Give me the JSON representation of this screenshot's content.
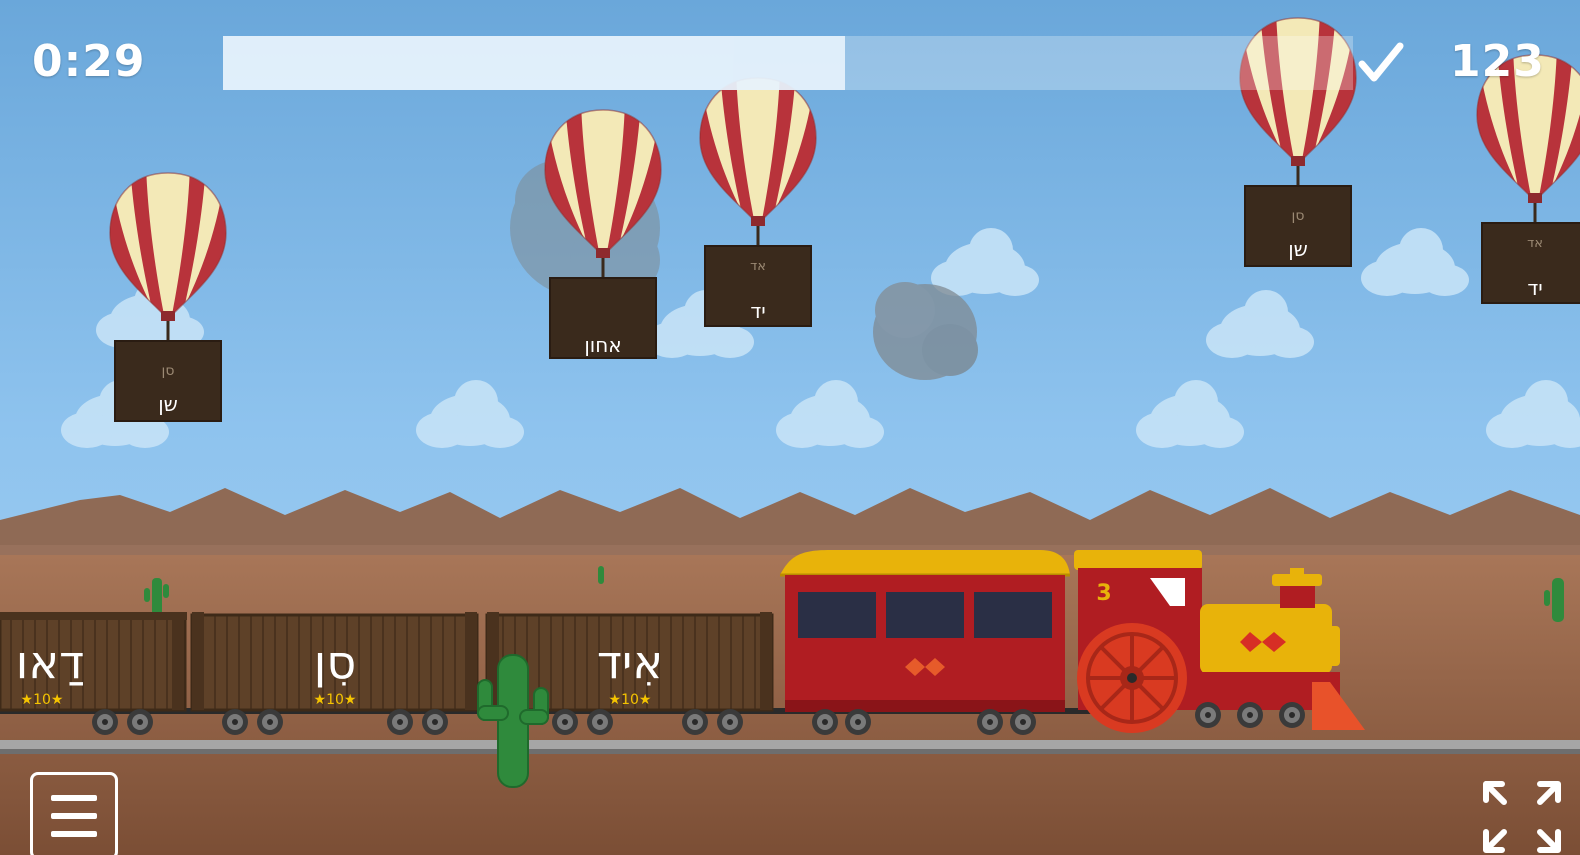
{
  "hud": {
    "timer": "0:29",
    "score": "123",
    "progress_fraction": 0.55
  },
  "balloons": [
    {
      "crate_small": "סן",
      "crate_main": "שן"
    },
    {
      "crate_small": "",
      "crate_main": "אחון"
    },
    {
      "crate_small": "אד",
      "crate_main": "יד"
    },
    {
      "crate_small": "סן",
      "crate_main": "שן"
    },
    {
      "crate_small": "אד",
      "crate_main": "יד"
    }
  ],
  "train": {
    "engine_number": "3",
    "wagons": [
      {
        "word": "דַאו",
        "points": "★10★"
      },
      {
        "word": "סִן",
        "points": "★10★"
      },
      {
        "word": "אִיד",
        "points": "★10★"
      }
    ]
  },
  "icons": {
    "check": "check-icon",
    "menu": "hamburger-menu-icon",
    "fullscreen": "fullscreen-expand-icon"
  },
  "colors": {
    "sky": "#7fbbe9",
    "mountains": "#8f6a55",
    "ground": "#8a5a3d",
    "crate": "#3a2a1c",
    "balloon_red": "#b8333b",
    "balloon_cream": "#f3e9b7",
    "coach_red": "#b01d22",
    "engine_yellow": "#f0b400"
  }
}
